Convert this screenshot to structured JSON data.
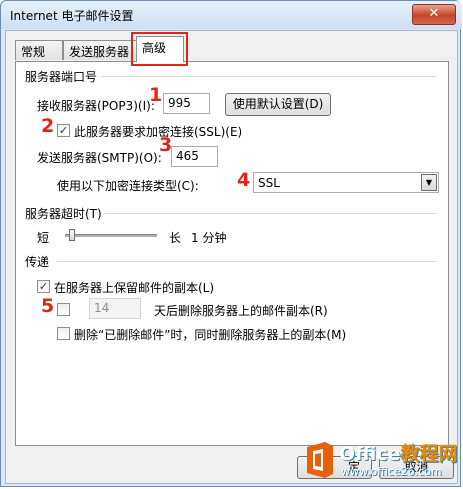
{
  "window": {
    "title": "Internet 电子邮件设置",
    "close_label": "✕"
  },
  "tabs": [
    {
      "label": "常规"
    },
    {
      "label": "发送服务器"
    },
    {
      "label": "高级"
    }
  ],
  "server_ports": {
    "group_label": "服务器端口号",
    "incoming_label": "接收服务器(POP3)(I):",
    "incoming_value": "995",
    "default_button": "使用默认设置(D)",
    "ssl_checkbox_label": "此服务器要求加密连接(SSL)(E)",
    "ssl_checked": true,
    "outgoing_label": "发送服务器(SMTP)(O):",
    "outgoing_value": "465",
    "encryption_label": "使用以下加密连接类型(C):",
    "encryption_value": "SSL"
  },
  "timeout": {
    "group_label": "服务器超时(T)",
    "short_label": "短",
    "long_label": "长",
    "value_label": "1 分钟",
    "level": 0.05
  },
  "delivery": {
    "group_label": "传递",
    "keep_copy_label": "在服务器上保留邮件的副本(L)",
    "keep_copy_checked": true,
    "remove_after_checked": false,
    "remove_after_days": "14",
    "remove_after_label": "天后删除服务器上的邮件副本(R)",
    "remove_deleted_checked": false,
    "remove_deleted_label": "删除“已删除邮件”时，同时删除服务器上的副本(M)"
  },
  "footer": {
    "ok_partial": "定",
    "cancel_partial": "取消"
  },
  "annotations": [
    "1",
    "2",
    "3",
    "4",
    "5"
  ],
  "watermark": {
    "brand_main": "Office",
    "brand_accent": "教程网",
    "url": "www.office26.com"
  },
  "colors": {
    "marker": "#e0251b",
    "watermark_orange": "#f08a00"
  }
}
